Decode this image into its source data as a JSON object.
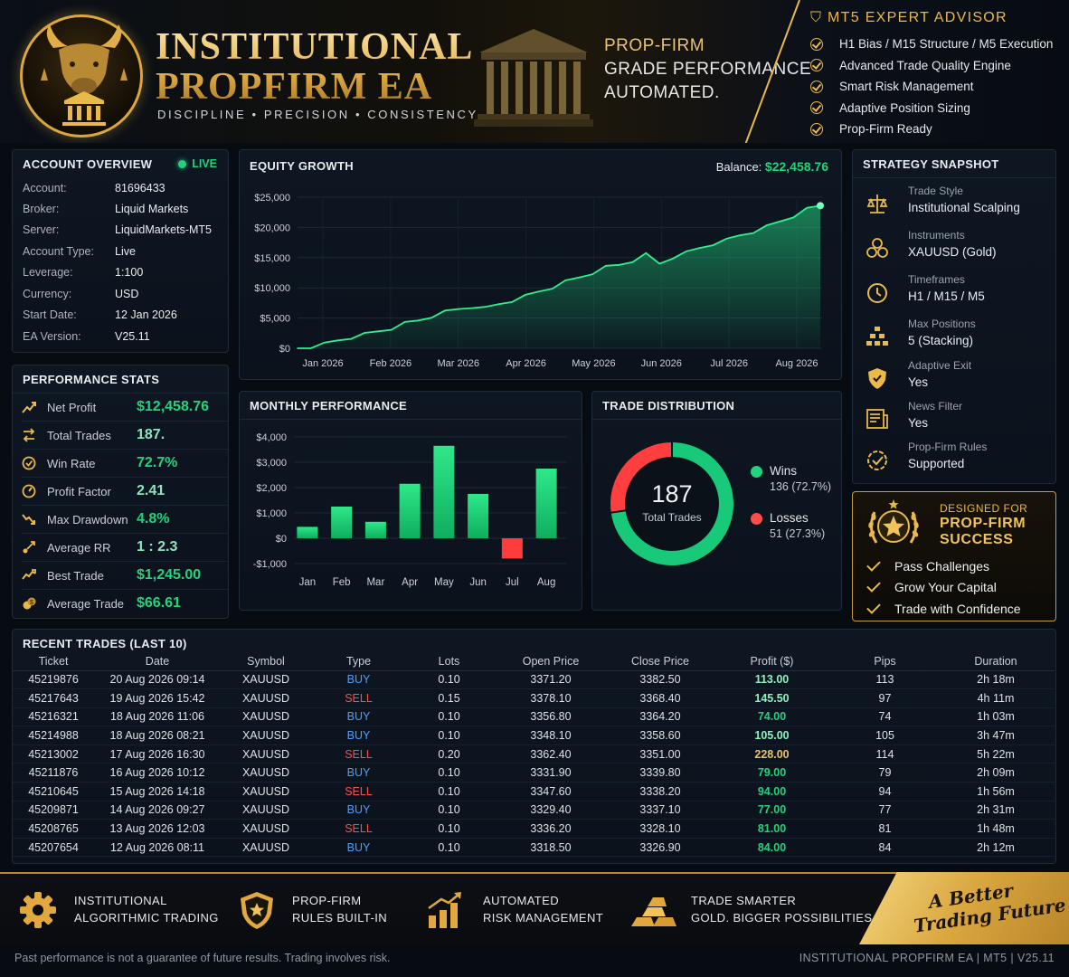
{
  "header": {
    "brand_line1": "INSTITUTIONAL",
    "brand_line2": "PROPFIRM EA",
    "subtitle": "DISCIPLINE  •  PRECISION  •  CONSISTENCY",
    "tagline": [
      "PROP-FIRM",
      "GRADE PERFORMANCE",
      "AUTOMATED."
    ],
    "advisor_title": "MT5 EXPERT ADVISOR",
    "advisor_features": [
      "H1 Bias / M15 Structure / M5 Execution",
      "Advanced Trade Quality Engine",
      "Smart Risk Management",
      "Adaptive Position Sizing",
      "Prop-Firm Ready"
    ]
  },
  "account_overview": {
    "title": "ACCOUNT OVERVIEW",
    "status": "LIVE",
    "rows": [
      {
        "k": "Account:",
        "v": "81696433"
      },
      {
        "k": "Broker:",
        "v": "Liquid Markets"
      },
      {
        "k": "Server:",
        "v": "LiquidMarkets-MT5"
      },
      {
        "k": "Account Type:",
        "v": "Live"
      },
      {
        "k": "Leverage:",
        "v": "1:100"
      },
      {
        "k": "Currency:",
        "v": "USD"
      },
      {
        "k": "Start Date:",
        "v": "12 Jan 2026"
      },
      {
        "k": "EA Version:",
        "v": "V25.11"
      }
    ]
  },
  "performance_stats": {
    "title": "PERFORMANCE STATS",
    "rows": [
      {
        "icon": "chart-up-icon",
        "label": "Net Profit",
        "value": "$12,458.76"
      },
      {
        "icon": "trades-icon",
        "label": "Total Trades",
        "value": "187."
      },
      {
        "icon": "target-icon",
        "label": "Win Rate",
        "value": "72.7%"
      },
      {
        "icon": "gauge-icon",
        "label": "Profit Factor",
        "value": "2.41"
      },
      {
        "icon": "drawdown-icon",
        "label": "Max Drawdown",
        "value": "4.8%"
      },
      {
        "icon": "ratio-icon",
        "label": "Average RR",
        "value": "1 : 2.3"
      },
      {
        "icon": "trophy-icon",
        "label": "Best Trade",
        "value": "$1,245.00"
      },
      {
        "icon": "coins-icon",
        "label": "Average Trade",
        "value": "$66.61"
      }
    ]
  },
  "equity_growth": {
    "title": "EQUITY GROWTH",
    "balance_label": "Balance:",
    "balance_value": "$22,458.76"
  },
  "monthly_performance": {
    "title": "MONTHLY PERFORMANCE"
  },
  "trade_distribution": {
    "title": "TRADE DISTRIBUTION",
    "total": "187",
    "total_label": "Total Trades",
    "wins_label": "Wins",
    "wins_value": "136 (72.7%)",
    "losses_label": "Losses",
    "losses_value": "51 (27.3%)"
  },
  "strategy_snapshot": {
    "title": "STRATEGY SNAPSHOT",
    "items": [
      {
        "icon": "scale-icon",
        "label": "Trade Style",
        "value": "Institutional Scalping"
      },
      {
        "icon": "gold-coins-icon",
        "label": "Instruments",
        "value": "XAUUSD (Gold)"
      },
      {
        "icon": "clock-icon",
        "label": "Timeframes",
        "value": "H1 / M15 / M5"
      },
      {
        "icon": "stack-icon",
        "label": "Max Positions",
        "value": "5 (Stacking)"
      },
      {
        "icon": "shield-icon",
        "label": "Adaptive Exit",
        "value": "Yes"
      },
      {
        "icon": "news-icon",
        "label": "News Filter",
        "value": "Yes"
      },
      {
        "icon": "rules-icon",
        "label": "Prop-Firm Rules",
        "value": "Supported"
      }
    ]
  },
  "designed_for": {
    "small": "DESIGNED FOR",
    "big_line1": "PROP-FIRM",
    "big_line2": "SUCCESS",
    "items": [
      "Pass Challenges",
      "Grow Your Capital",
      "Trade with Confidence"
    ]
  },
  "recent_trades": {
    "title": "RECENT TRADES  (LAST 10)",
    "columns": [
      "Ticket",
      "Date",
      "Symbol",
      "Type",
      "Lots",
      "Open Price",
      "Close Price",
      "Profit ($)",
      "Pips",
      "Duration"
    ],
    "rows": [
      [
        "45219876",
        "20 Aug 2026 09:14",
        "XAUUSD",
        "BUY",
        "0.10",
        "3371.20",
        "3382.50",
        "113.00",
        "113",
        "2h 18m"
      ],
      [
        "45217643",
        "19 Aug 2026 15:42",
        "XAUUSD",
        "SELL",
        "0.15",
        "3378.10",
        "3368.40",
        "145.50",
        "97",
        "4h 11m"
      ],
      [
        "45216321",
        "18 Aug 2026 11:06",
        "XAUUSD",
        "BUY",
        "0.10",
        "3356.80",
        "3364.20",
        "74.00",
        "74",
        "1h 03m"
      ],
      [
        "45214988",
        "18 Aug 2026 08:21",
        "XAUUSD",
        "BUY",
        "0.10",
        "3348.10",
        "3358.60",
        "105.00",
        "105",
        "3h 47m"
      ],
      [
        "45213002",
        "17 Aug 2026 16:30",
        "XAUUSD",
        "SELL",
        "0.20",
        "3362.40",
        "3351.00",
        "228.00",
        "114",
        "5h 22m"
      ],
      [
        "45211876",
        "16 Aug 2026 10:12",
        "XAUUSD",
        "BUY",
        "0.10",
        "3331.90",
        "3339.80",
        "79.00",
        "79",
        "2h 09m"
      ],
      [
        "45210645",
        "15 Aug 2026 14:18",
        "XAUUSD",
        "SELL",
        "0.10",
        "3347.60",
        "3338.20",
        "94.00",
        "94",
        "1h 56m"
      ],
      [
        "45209871",
        "14 Aug 2026 09:27",
        "XAUUSD",
        "BUY",
        "0.10",
        "3329.40",
        "3337.10",
        "77.00",
        "77",
        "2h 31m"
      ],
      [
        "45208765",
        "13 Aug 2026 12:03",
        "XAUUSD",
        "SELL",
        "0.10",
        "3336.20",
        "3328.10",
        "81.00",
        "81",
        "1h 48m"
      ],
      [
        "45207654",
        "12 Aug 2026 08:11",
        "XAUUSD",
        "BUY",
        "0.10",
        "3318.50",
        "3326.90",
        "84.00",
        "84",
        "2h 12m"
      ]
    ]
  },
  "footer": {
    "features": [
      {
        "icon": "gear-icon",
        "line1": "INSTITUTIONAL",
        "line2": "ALGORITHMIC TRADING"
      },
      {
        "icon": "shield-star-icon",
        "line1": "PROP-FIRM",
        "line2": "RULES BUILT-IN"
      },
      {
        "icon": "bars-arrow-icon",
        "line1": "AUTOMATED",
        "line2": "RISK MANAGEMENT"
      },
      {
        "icon": "gold-bars-icon",
        "line1": "TRADE SMARTER",
        "line2": "GOLD. BIGGER POSSIBILITIES."
      }
    ],
    "slogan_line1": "A Better",
    "slogan_line2": "Trading Future",
    "disclaimer": "Past performance is not a guarantee of future results. Trading involves risk.",
    "right_text": "INSTITUTIONAL PROPFIRM EA  |  MT5  |  V25.11"
  },
  "colors": {
    "green": "#22d37e",
    "red": "#ff4d4d",
    "gold": "#e9b949",
    "blue": "#4aa0ff",
    "bg": "#070b12"
  },
  "chart_data": [
    {
      "type": "area",
      "x": [
        "Jan 2026",
        "Feb 2026",
        "Mar 2026",
        "Apr 2026",
        "May 2026",
        "Jun 2026",
        "Jul 2026",
        "Aug 2026"
      ],
      "xticks": [
        "Jan 2026",
        "Feb 2026",
        "Mar 2026",
        "Apr 2026",
        "May 2026",
        "Jun 2026",
        "Jul 2026",
        "Aug 2026"
      ],
      "yticks": [
        "$0",
        "$5,000",
        "$10,000",
        "$15,000",
        "$20,000",
        "$25,000"
      ],
      "ylim": [
        0,
        25000
      ],
      "series": [
        {
          "values": [
            0,
            200,
            700,
            1300,
            1900,
            2300,
            2800,
            3400,
            4100,
            4600,
            5400,
            6000,
            6500,
            7000,
            6600,
            7300,
            8000,
            8600,
            9400,
            10200,
            11000,
            11700,
            12600,
            13400,
            13800,
            14600,
            15500,
            14000,
            15200,
            15800,
            16600,
            17400,
            17900,
            18700,
            19400,
            20100,
            21000,
            22000,
            23000,
            23600
          ]
        }
      ]
    },
    {
      "type": "bar",
      "categories": [
        "Jan",
        "Feb",
        "Mar",
        "Apr",
        "May",
        "Jun",
        "Jul",
        "Aug"
      ],
      "values": [
        450,
        1250,
        650,
        2150,
        3650,
        1750,
        -800,
        2750
      ],
      "yticks": [
        "-$1,000",
        "$0",
        "$1,000",
        "$2,000",
        "$3,000",
        "$4,000"
      ],
      "ylim": [
        -1000,
        4000
      ]
    },
    {
      "type": "pie",
      "categories": [
        "Wins",
        "Losses"
      ],
      "values": [
        136,
        51
      ]
    }
  ]
}
